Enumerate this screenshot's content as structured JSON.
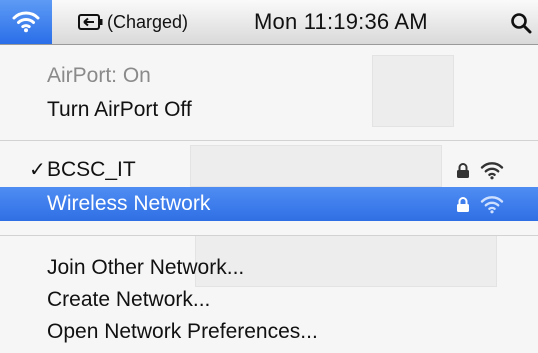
{
  "menubar": {
    "battery_status": "(Charged)",
    "clock": "Mon 11:19:36 AM",
    "icons": [
      "wifi-icon",
      "battery-charging-icon",
      "spotlight-search-icon"
    ],
    "accent_color": "#3478f0"
  },
  "menu": {
    "airport_status": "AirPort: On",
    "toggle_airport": "Turn AirPort Off",
    "networks": [
      {
        "name": "BCSC_IT",
        "checked": true,
        "locked": true,
        "selected": false
      },
      {
        "name": "Wireless Network",
        "checked": false,
        "locked": true,
        "selected": true
      }
    ],
    "check_mark": "✓",
    "join_other": "Join Other Network...",
    "create_network": "Create Network...",
    "open_prefs": "Open Network Preferences..."
  }
}
